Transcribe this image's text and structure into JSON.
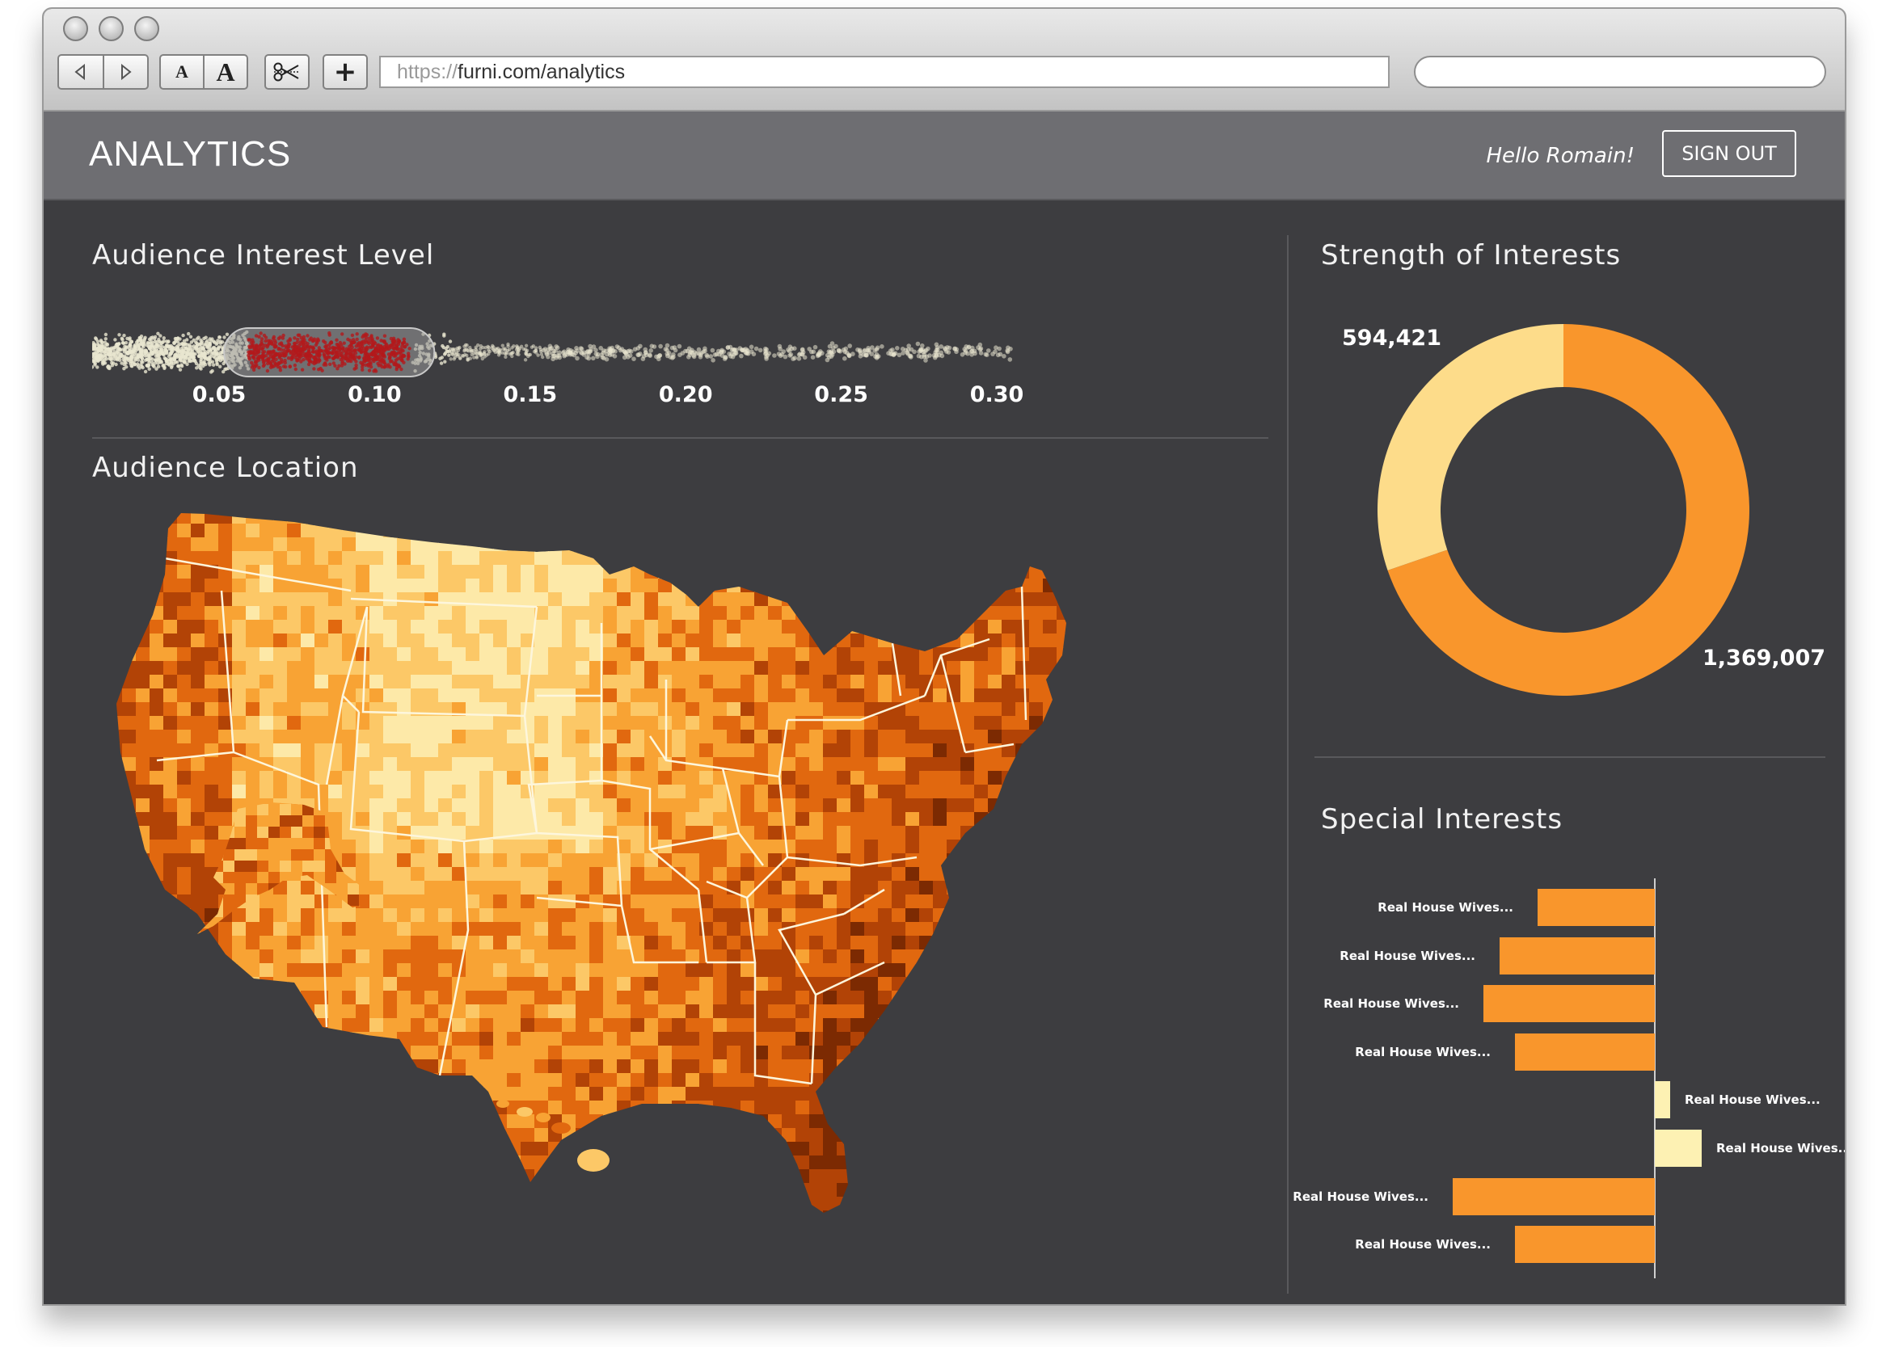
{
  "browser": {
    "url_protocol": "https://",
    "url_path": "furni.com/analytics",
    "font_small_label": "A",
    "font_large_label": "A",
    "add_label": "+",
    "icons": [
      "back-arrow-icon",
      "forward-arrow-icon",
      "scissors-icon"
    ]
  },
  "header": {
    "title": "ANALYTICS",
    "greeting": "Hello Romain!",
    "sign_out": "SIGN OUT"
  },
  "interest_level": {
    "title": "Audience Interest Level",
    "ticks": [
      "0.05",
      "0.10",
      "0.15",
      "0.20",
      "0.25",
      "0.30"
    ],
    "selected_range": [
      0.075,
      0.127
    ],
    "colors": {
      "selected": "#b3191b",
      "points": "#e9e6d0"
    }
  },
  "location": {
    "title": "Audience Location",
    "colors": [
      "#fde9a8",
      "#fcc867",
      "#f8a334",
      "#e1680f",
      "#b24306",
      "#7c2a02"
    ]
  },
  "strength": {
    "title": "Strength of Interests",
    "chart_data": {
      "type": "pie",
      "values": [
        1369007,
        594421
      ],
      "labels": [
        "1,369,007",
        "594,421"
      ],
      "colors": [
        "#f9962c",
        "#fddc8a"
      ]
    }
  },
  "special": {
    "title": "Special Interests",
    "chart_data": {
      "type": "bar",
      "orientation": "horizontal",
      "categories": [
        "Real House Wives...",
        "Real House Wives...",
        "Real House Wives...",
        "Real House Wives...",
        "Real House Wives...",
        "Real House Wives...",
        "Real House Wives...",
        "Real House Wives..."
      ],
      "values": [
        -145,
        -192,
        -212,
        -173,
        19,
        58,
        -250,
        -173
      ],
      "colors": {
        "negative": "#f9962c",
        "positive": "#fdf1b3"
      }
    }
  }
}
